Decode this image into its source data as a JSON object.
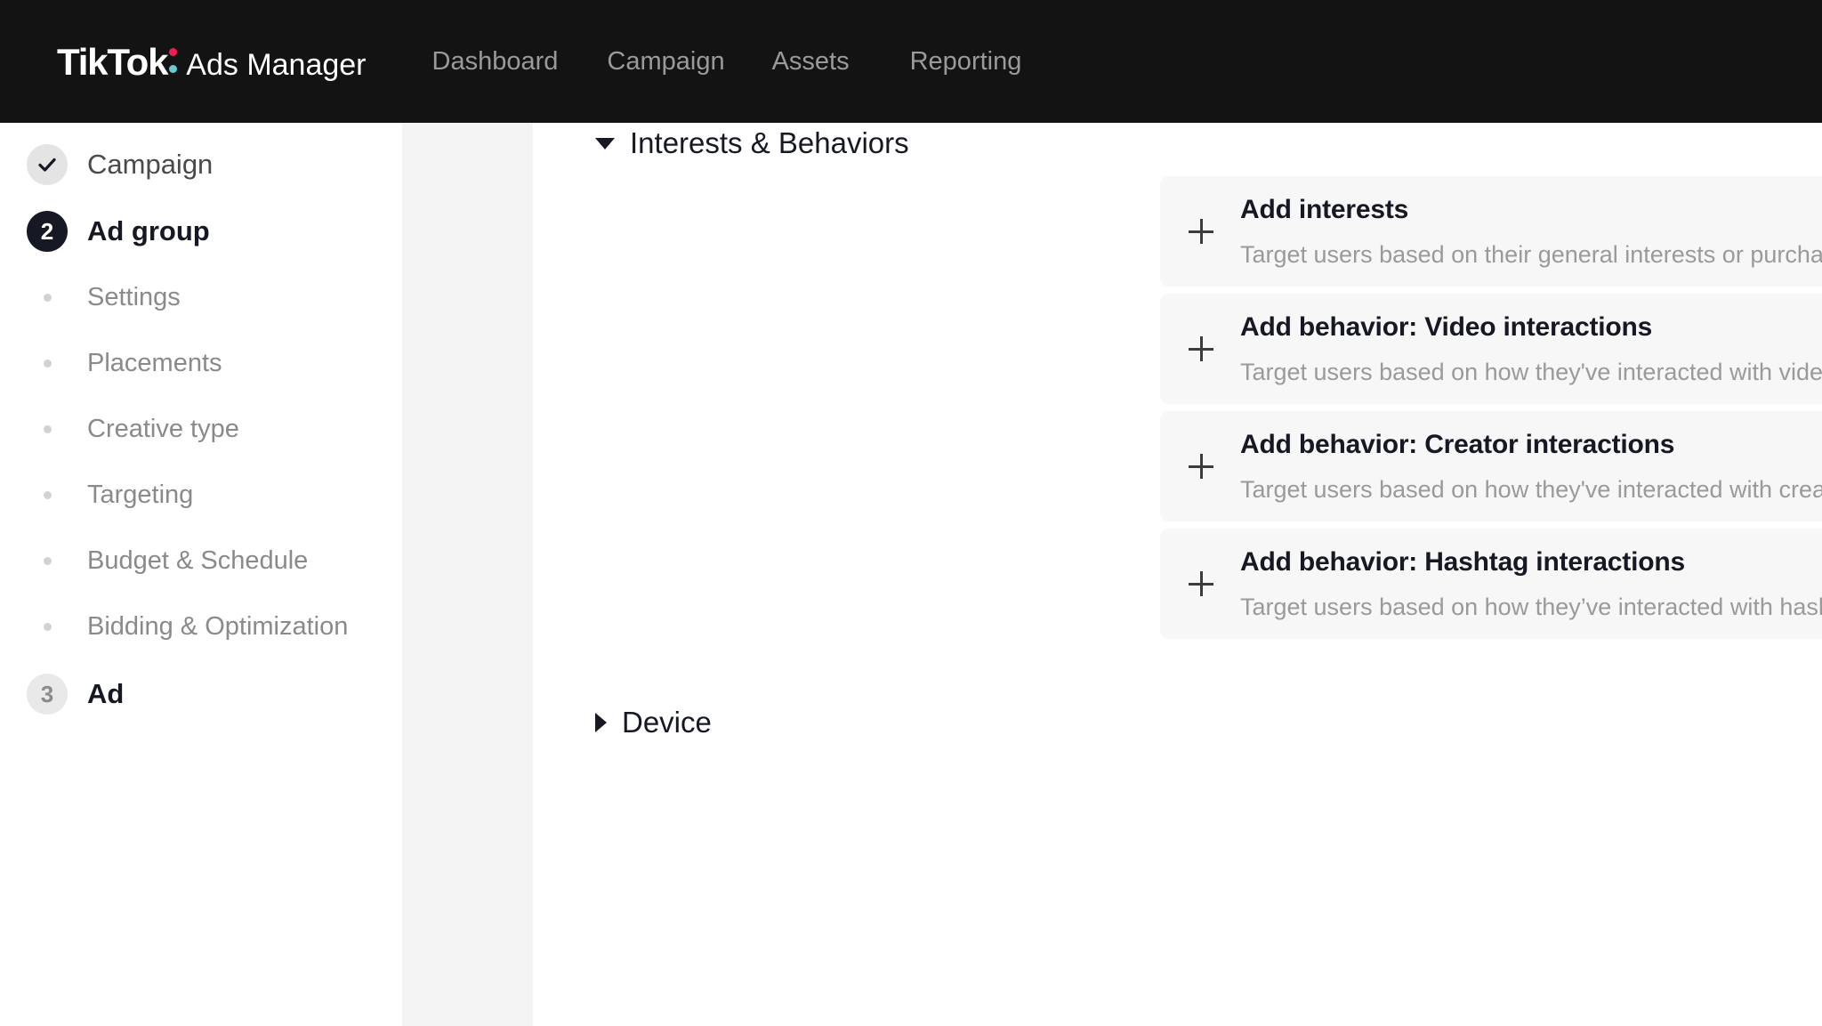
{
  "header": {
    "brand_primary": "TikTok",
    "brand_secondary": "Ads Manager",
    "nav": [
      {
        "label": "Dashboard"
      },
      {
        "label": "Campaign"
      },
      {
        "label": "Assets"
      },
      {
        "label": "Reporting"
      }
    ]
  },
  "sidebar": {
    "steps": [
      {
        "marker": "✓",
        "label": "Campaign",
        "state": "done"
      },
      {
        "marker": "2",
        "label": "Ad group",
        "state": "active"
      },
      {
        "marker": "3",
        "label": "Ad",
        "state": "todo"
      }
    ],
    "subitems": [
      {
        "label": "Settings"
      },
      {
        "label": "Placements"
      },
      {
        "label": "Creative type"
      },
      {
        "label": "Targeting"
      },
      {
        "label": "Budget & Schedule"
      },
      {
        "label": "Bidding & Optimization"
      }
    ]
  },
  "main": {
    "sections": [
      {
        "title": "Interests & Behaviors",
        "expanded": true
      },
      {
        "title": "Device",
        "expanded": false
      }
    ],
    "cards": [
      {
        "plus": "+",
        "title": "Add interests",
        "description": "Target users based on their general interests or purchase intentions."
      },
      {
        "plus": "+",
        "title": "Add behavior: Video interactions",
        "description": "Target users based on how they've interacted with videos on TikTok."
      },
      {
        "plus": "+",
        "title": "Add behavior: Creator interactions",
        "description": "Target users based on how they've interacted with creators on TikTok."
      },
      {
        "plus": "+",
        "title": "Add behavior: Hashtag interactions",
        "description": "Target users based on how they’ve interacted with hashtags on TikTok."
      }
    ]
  },
  "colors": {
    "header_bg": "#131313",
    "accent_red": "#ee1d52",
    "accent_cyan": "#69c9d0",
    "card_bg": "#f7f7f7",
    "spacer_bg": "#f4f4f4",
    "text_primary": "#161823",
    "text_muted": "#9a9a9a"
  }
}
